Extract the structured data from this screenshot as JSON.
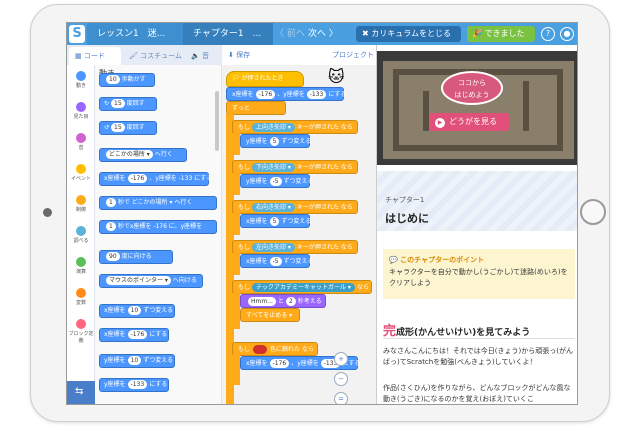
{
  "topbar": {
    "logo": "S",
    "lesson": "レッスン1　迷...",
    "chapter": "チャプター1　...",
    "prev": "〈 前へ",
    "next": "次へ 〉",
    "close_curriculum": "✖ カリキュラムをとじる",
    "done": "🎉 できました"
  },
  "tabs": {
    "code": "コード",
    "costume": "コスチューム",
    "sound": "音",
    "save": "保存",
    "project": "プロジェクト ▾"
  },
  "categories": [
    {
      "label": "動き",
      "color": "#4c97ff"
    },
    {
      "label": "見た目",
      "color": "#9966ff"
    },
    {
      "label": "音",
      "color": "#cf63cf"
    },
    {
      "label": "イベント",
      "color": "#ffbf00"
    },
    {
      "label": "制御",
      "color": "#ffab19"
    },
    {
      "label": "調べる",
      "color": "#5cb1d6"
    },
    {
      "label": "演算",
      "color": "#59c059"
    },
    {
      "label": "変数",
      "color": "#ff8c1a"
    },
    {
      "label": "ブロック定義",
      "color": "#ff6680"
    }
  ],
  "palette": {
    "title": "動き",
    "blocks": [
      {
        "pre": "",
        "val": "10",
        "post": "歩動かす"
      },
      {
        "pre": "↻",
        "val": "15",
        "post": "度回す"
      },
      {
        "pre": "↺",
        "val": "15",
        "post": "度回す"
      },
      {
        "pre": "",
        "val": "どこかの場所 ▾",
        "post": "へ行く"
      },
      {
        "pre": "x座標を",
        "val": "-176",
        "post": "、y座標を -133 にする"
      },
      {
        "pre": "",
        "val": "1",
        "post": "秒で どこかの場所 ▾ へ行く"
      },
      {
        "pre": "",
        "val": "1",
        "post": "秒でx座標を -176 に、y座標を"
      },
      {
        "pre": "",
        "val": "90",
        "post": "度に向ける"
      },
      {
        "pre": "",
        "val": "マウスのポインター ▾",
        "post": "へ向ける"
      },
      {
        "pre": "x座標を",
        "val": "10",
        "post": "ずつ変える"
      },
      {
        "pre": "x座標を",
        "val": "-176",
        "post": "にする"
      },
      {
        "pre": "y座標を",
        "val": "10",
        "post": "ずつ変える"
      },
      {
        "pre": "y座標を",
        "val": "-133",
        "post": "にする"
      }
    ]
  },
  "script": {
    "hat": "🏳 が押されたとき",
    "goto": {
      "pre": "x座標を",
      "x": "-176",
      "mid": "、y座標を",
      "y": "-133",
      "post": "にする"
    },
    "forever": "ずっと",
    "ifs": [
      {
        "if": "もし",
        "key": "上向き矢印 ▾",
        "keytext": "キーが押された",
        "then": "なら",
        "change": "y座標を",
        "val": "5",
        "post": "ずつ変える"
      },
      {
        "if": "もし",
        "key": "下向き矢印 ▾",
        "keytext": "キーが押された",
        "then": "なら",
        "change": "y座標を",
        "val": "-5",
        "post": "ずつ変える"
      },
      {
        "if": "もし",
        "key": "右向き矢印 ▾",
        "keytext": "キーが押された",
        "then": "なら",
        "change": "x座標を",
        "val": "5",
        "post": "ずつ変える"
      },
      {
        "if": "もし",
        "key": "左向き矢印 ▾",
        "keytext": "キーが押された",
        "then": "なら",
        "change": "x座標を",
        "val": "-5",
        "post": "ずつ変える"
      }
    ],
    "touch_if": {
      "if": "もし",
      "sprite": "テックアカデミーキャットガール ▾",
      "then": "なら"
    },
    "say": {
      "val": "Hmm...",
      "mid": "と",
      "secs": "2",
      "post": "秒考える"
    },
    "stop": "すべてを止める ▾",
    "color_if": {
      "if": "もし",
      "post": "色に触れた",
      "then": "なら",
      "color": "#d0312d"
    },
    "goto2": {
      "pre": "x座標を",
      "x": "-176",
      "mid": "、y座標を",
      "y": "-133",
      "post": "にする"
    }
  },
  "stage": {
    "bubble": "ココから\nはじめよう",
    "play": "どうがを見る"
  },
  "chapter": {
    "label": "チャプター1",
    "title": "はじめに"
  },
  "point": {
    "title": "💬 このチャプターのポイント",
    "body": "キャラクターを自分で動かし(うごかし)て迷路(めいろ)をクリアしよう"
  },
  "section": {
    "big": "完",
    "rest": "成形(かんせいけい)を見てみよう"
  },
  "paragraphs": [
    "みなさんこんにちは！それでは今日(きょう)から頑張っ(がんばっ)てScratchを勉強(べんきょう)していくよ！",
    "作品(さくひん)を作りながら、どんなブロックがどんな風な動き(うごき)になるのかを覚え(おぼえ)ていくこ"
  ]
}
